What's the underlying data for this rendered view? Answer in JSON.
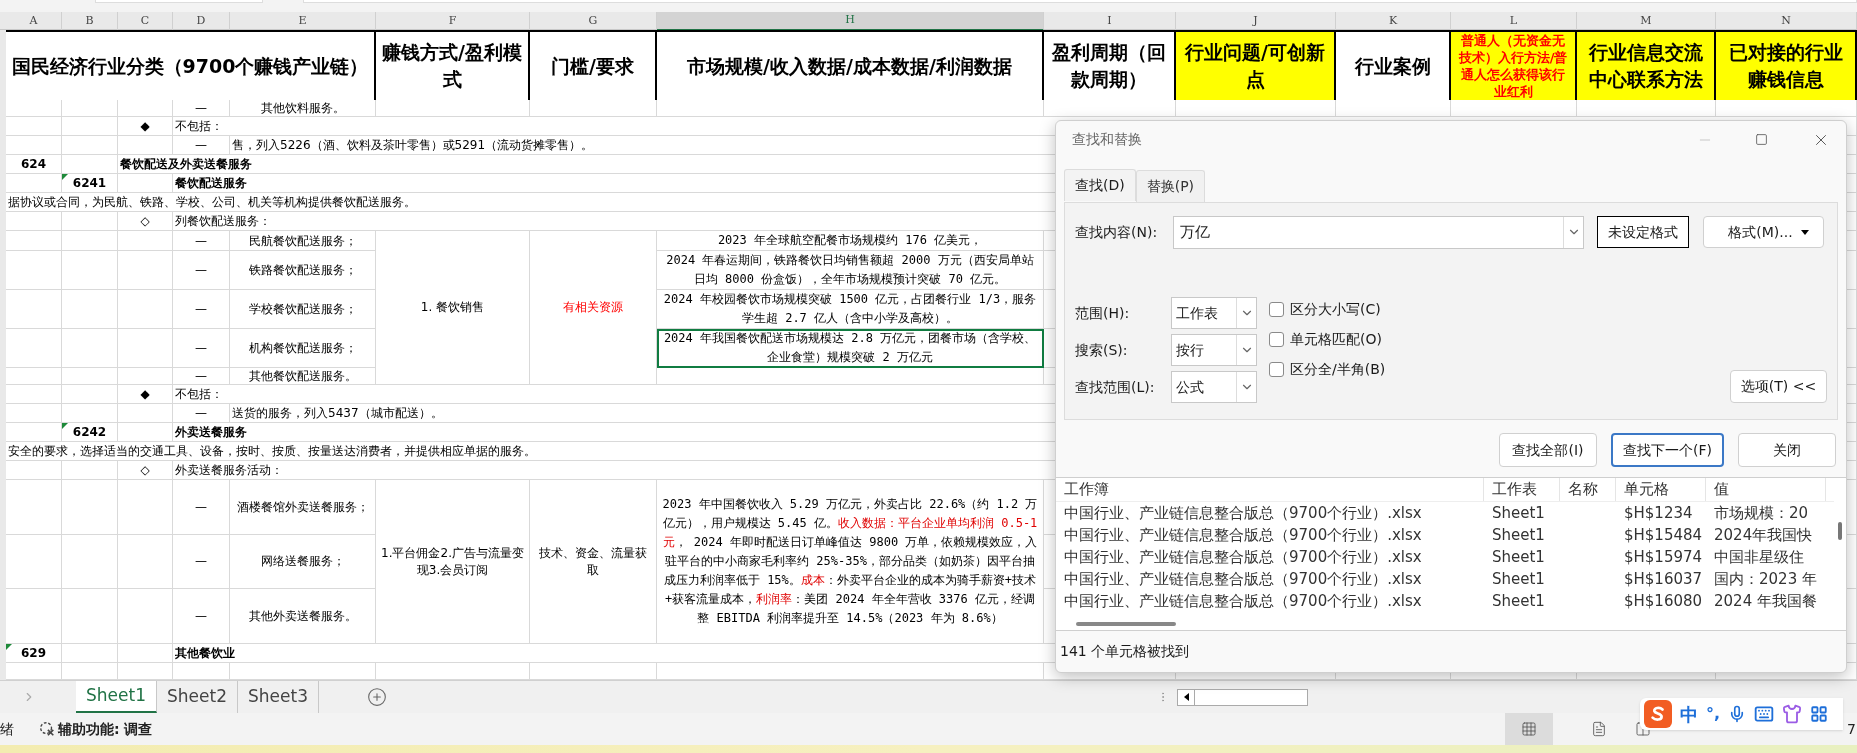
{
  "sheet": {
    "columns": [
      {
        "letter": "A",
        "selected": false
      },
      {
        "letter": "B",
        "selected": false
      },
      {
        "letter": "C",
        "selected": false
      },
      {
        "letter": "D",
        "selected": false
      },
      {
        "letter": "E",
        "selected": false
      },
      {
        "letter": "F",
        "selected": false
      },
      {
        "letter": "G",
        "selected": false
      },
      {
        "letter": "H",
        "selected": true
      },
      {
        "letter": "I",
        "selected": false
      },
      {
        "letter": "J",
        "selected": false
      },
      {
        "letter": "K",
        "selected": false
      },
      {
        "letter": "L",
        "selected": false
      },
      {
        "letter": "M",
        "selected": false
      },
      {
        "letter": "N",
        "selected": false
      }
    ],
    "header": {
      "a": {
        "text": "国民经济行业分类（9700个赚钱产业链）",
        "highlight": false,
        "red_text": false
      },
      "f": {
        "text": "赚钱方式/盈利模式",
        "highlight": false,
        "red_text": false
      },
      "g": {
        "text": "门槛/要求",
        "highlight": false,
        "red_text": false
      },
      "h": {
        "text": "市场规模/收入数据/成本数据/利润数据",
        "highlight": false,
        "red_text": false
      },
      "i": {
        "text": "盈利周期（回款周期）",
        "highlight": false,
        "red_text": false
      },
      "j": {
        "text": "行业问题/可创新点",
        "highlight": true,
        "red_text": false
      },
      "k": {
        "text": "行业案例",
        "highlight": false,
        "red_text": false
      },
      "l": {
        "text": "普通人（无资金无技术）入行方法/普通人怎么获得该行业红利",
        "highlight": true,
        "red_text": true
      },
      "m": {
        "text": "行业信息交流中心联系方法",
        "highlight": true,
        "red_text": false
      },
      "n": {
        "text": "已对接的行业赚钱信息",
        "highlight": true,
        "red_text": false
      }
    },
    "rows": [
      {
        "kind": "item",
        "cells": {
          "d": {
            "text": "—",
            "selected": false,
            "flagged": false
          },
          "e": {
            "text": "其他饮料服务。",
            "selected": false,
            "flagged": false
          }
        }
      },
      {
        "kind": "note",
        "cells": {
          "c": {
            "text": "◆",
            "selected": false,
            "flagged": false
          },
          "d": {
            "text": "不包括：",
            "selected": false,
            "flagged": false
          }
        }
      },
      {
        "kind": "note",
        "cells": {
          "d": {
            "text": "—",
            "selected": false,
            "flagged": false
          },
          "e": {
            "text": "售，列入5226（酒、饮料及茶叶零售）或5291（流动货摊零售）。",
            "selected": false,
            "flagged": false
          }
        }
      },
      {
        "kind": "heading",
        "cells": {
          "a": {
            "text": "624",
            "selected": false,
            "flagged": false
          },
          "c": {
            "text": "餐饮配送及外卖送餐服务",
            "selected": false,
            "flagged": false
          }
        }
      },
      {
        "kind": "heading",
        "cells": {
          "b": {
            "text": "6241",
            "selected": false,
            "flagged": true
          },
          "d": {
            "text": "餐饮配送服务",
            "selected": false,
            "flagged": false
          }
        }
      },
      {
        "kind": "note",
        "cells": {
          "a": {
            "text": "据协议或合同，为民航、铁路、学校、公司、机关等机构提供餐饮配送服务。",
            "selected": false,
            "flagged": false
          }
        }
      },
      {
        "kind": "note",
        "cells": {
          "c": {
            "text": "◇",
            "selected": false,
            "flagged": false
          },
          "d": {
            "text": "列餐饮配送服务：",
            "selected": false,
            "flagged": false
          }
        }
      },
      {
        "kind": "block",
        "merged": {
          "f": {
            "text": "1. 餐饮销售",
            "selected": false,
            "flagged": false,
            "red_text": false
          },
          "g": {
            "text": "有相关资源",
            "selected": false,
            "flagged": false,
            "red_text": true
          }
        },
        "rows": [
          {
            "kind": "item",
            "cells": {
              "d": {
                "text": "—",
                "selected": false,
                "flagged": false
              },
              "e": {
                "text": "民航餐饮配送服务；",
                "selected": false,
                "flagged": false
              },
              "h": {
                "text": "2023 年全球航空配餐市场规模约 176 亿美元，",
                "selected": false,
                "flagged": false
              }
            }
          },
          {
            "kind": "item",
            "cells": {
              "d": {
                "text": "—",
                "selected": false,
                "flagged": false
              },
              "e": {
                "text": "铁路餐饮配送服务；",
                "selected": false,
                "flagged": false
              },
              "h": {
                "text": "2024 年春运期间，铁路餐饮日均销售额超 2000 万元（西安局单站日均 8000 份盒饭），全年市场规模预计突破 70 亿元。",
                "selected": false,
                "flagged": false
              }
            }
          },
          {
            "kind": "item",
            "cells": {
              "d": {
                "text": "—",
                "selected": false,
                "flagged": false
              },
              "e": {
                "text": "学校餐饮配送服务；",
                "selected": false,
                "flagged": false
              },
              "h": {
                "text": "2024 年校园餐饮市场规模突破 1500 亿元，占团餐行业 1/3，服务学生超 2.7 亿人（含中小学及高校）。",
                "selected": false,
                "flagged": false
              }
            }
          },
          {
            "kind": "item",
            "cells": {
              "d": {
                "text": "—",
                "selected": false,
                "flagged": false
              },
              "e": {
                "text": "机构餐饮配送服务；",
                "selected": false,
                "flagged": false
              },
              "h": {
                "text": "2024 年我国餐饮配送市场规模达 2.8 万亿元，团餐市场（含学校、企业食堂）规模突破 2 万亿元",
                "selected": true,
                "flagged": false
              }
            }
          },
          {
            "kind": "item",
            "cells": {
              "d": {
                "text": "—",
                "selected": false,
                "flagged": false
              },
              "e": {
                "text": "其他餐饮配送服务。",
                "selected": false,
                "flagged": false
              }
            }
          }
        ]
      },
      {
        "kind": "note",
        "cells": {
          "c": {
            "text": "◆",
            "selected": false,
            "flagged": false
          },
          "d": {
            "text": "不包括：",
            "selected": false,
            "flagged": false
          }
        }
      },
      {
        "kind": "note",
        "cells": {
          "d": {
            "text": "—",
            "selected": false,
            "flagged": false
          },
          "e": {
            "text": "送货的服务，列入5437（城市配送）。",
            "selected": false,
            "flagged": false
          }
        }
      },
      {
        "kind": "heading",
        "cells": {
          "b": {
            "text": "6242",
            "selected": false,
            "flagged": true
          },
          "d": {
            "text": "外卖送餐服务",
            "selected": false,
            "flagged": false
          }
        }
      },
      {
        "kind": "note",
        "cells": {
          "a": {
            "text": "安全的要求，选择适当的交通工具、设备，按时、按质、按量送达消费者，并提供相应单据的服务。",
            "selected": false,
            "flagged": false
          }
        }
      },
      {
        "kind": "note",
        "cells": {
          "c": {
            "text": "◇",
            "selected": false,
            "flagged": false
          },
          "d": {
            "text": "外卖送餐服务活动：",
            "selected": false,
            "flagged": false
          }
        }
      },
      {
        "kind": "block",
        "merged": {
          "f": {
            "text": "1.平台佣金2.广告与流量变现3.会员订阅",
            "selected": false,
            "flagged": false,
            "red_text": false
          },
          "g": {
            "text": "技术、资金、流量获取",
            "selected": false,
            "flagged": false,
            "red_text": false
          },
          "h": {
            "selected": false,
            "flagged": false,
            "segments": [
              {
                "text": "2023 年中国餐饮收入 5.29 万亿元，外卖占比 22.6%（约 1.2 万亿元），用户规模达 5.45 亿。",
                "highlight": false
              },
              {
                "text": "收入数据：平台企业单均利润 0.5-1 元",
                "highlight": true
              },
              {
                "text": "， 2024 年即时配送日订单峰值达 9800 万单，依赖规模效应，入驻平台的中小商家毛利率约 25%-35%，部分品类（如奶茶）因平台抽成压力利润率低于 15%。",
                "highlight": false
              },
              {
                "text": "成本",
                "highlight": true
              },
              {
                "text": "：外卖平台企业的成本为骑手薪资+技术+获客流量成本，",
                "highlight": false
              },
              {
                "text": "利润率",
                "highlight": true
              },
              {
                "text": "：美团 2024 年全年营收 3376 亿元，经调整 EBITDA 利润率提升至 14.5%（2023 年为 8.6%）",
                "highlight": false
              }
            ]
          }
        },
        "rows": [
          {
            "kind": "item",
            "cells": {
              "d": {
                "text": "—",
                "selected": false,
                "flagged": false
              },
              "e": {
                "text": "酒楼餐馆外卖送餐服务；",
                "selected": false,
                "flagged": false
              }
            }
          },
          {
            "kind": "item",
            "cells": {
              "d": {
                "text": "—",
                "selected": false,
                "flagged": false
              },
              "e": {
                "text": "网络送餐服务；",
                "selected": false,
                "flagged": false
              }
            }
          },
          {
            "kind": "item",
            "cells": {
              "d": {
                "text": "—",
                "selected": false,
                "flagged": false
              },
              "e": {
                "text": "其他外卖送餐服务。",
                "selected": false,
                "flagged": false
              }
            }
          }
        ]
      },
      {
        "kind": "heading",
        "cells": {
          "a": {
            "text": "629",
            "selected": false,
            "flagged": true
          },
          "d": {
            "text": "其他餐饮业",
            "selected": false,
            "flagged": false
          }
        }
      }
    ],
    "tabs": [
      {
        "label": "Sheet1",
        "selected": true
      },
      {
        "label": "Sheet2",
        "selected": false
      },
      {
        "label": "Sheet3",
        "selected": false
      }
    ]
  },
  "find_dialog": {
    "title": "查找和替换",
    "tabs": [
      {
        "label": "查找(D)",
        "selected": true
      },
      {
        "label": "替换(P)",
        "selected": false
      }
    ],
    "find_label": "查找内容(N):",
    "find_value": "万亿",
    "format_status": "未设定格式",
    "format_button": "格式(M)...",
    "options": [
      {
        "label": "范围(H):",
        "value": "工作表"
      },
      {
        "label": "搜索(S):",
        "value": "按行"
      },
      {
        "label": "查找范围(L):",
        "value": "公式"
      }
    ],
    "checkboxes": [
      {
        "label": "区分大小写(C)",
        "checked": false
      },
      {
        "label": "单元格匹配(O)",
        "checked": false
      },
      {
        "label": "区分全/半角(B)",
        "checked": false
      }
    ],
    "options_button": "选项(T) <<",
    "buttons": [
      {
        "label": "查找全部(I)",
        "focused": false
      },
      {
        "label": "查找下一个(F)",
        "focused": true
      },
      {
        "label": "关闭",
        "focused": false
      }
    ],
    "results": {
      "columns": [
        "工作簿",
        "工作表",
        "名称",
        "单元格",
        "值"
      ],
      "rows": [
        {
          "workbook": "中国行业、产业链信息整合版总（9700个行业）.xlsx",
          "sheet": "Sheet1",
          "cell": "$H$1234",
          "value": "市场规模：20"
        },
        {
          "workbook": "中国行业、产业链信息整合版总（9700个行业）.xlsx",
          "sheet": "Sheet1",
          "cell": "$H$15484",
          "value": "2024年我国快"
        },
        {
          "workbook": "中国行业、产业链信息整合版总（9700个行业）.xlsx",
          "sheet": "Sheet1",
          "cell": "$H$15974",
          "value": "中国非星级住"
        },
        {
          "workbook": "中国行业、产业链信息整合版总（9700个行业）.xlsx",
          "sheet": "Sheet1",
          "cell": "$H$16037",
          "value": "国内：2023 年"
        },
        {
          "workbook": "中国行业、产业链信息整合版总（9700个行业）.xlsx",
          "sheet": "Sheet1",
          "cell": "$H$16080",
          "value": "2024 年我国餐"
        }
      ]
    },
    "footer": "141 个单元格被找到"
  },
  "status_bar": {
    "ready": "绪",
    "accessibility": "辅助功能: 调查",
    "zoom": "7"
  },
  "ime_bar": {
    "mode": "中",
    "punctuation": "°,"
  }
}
